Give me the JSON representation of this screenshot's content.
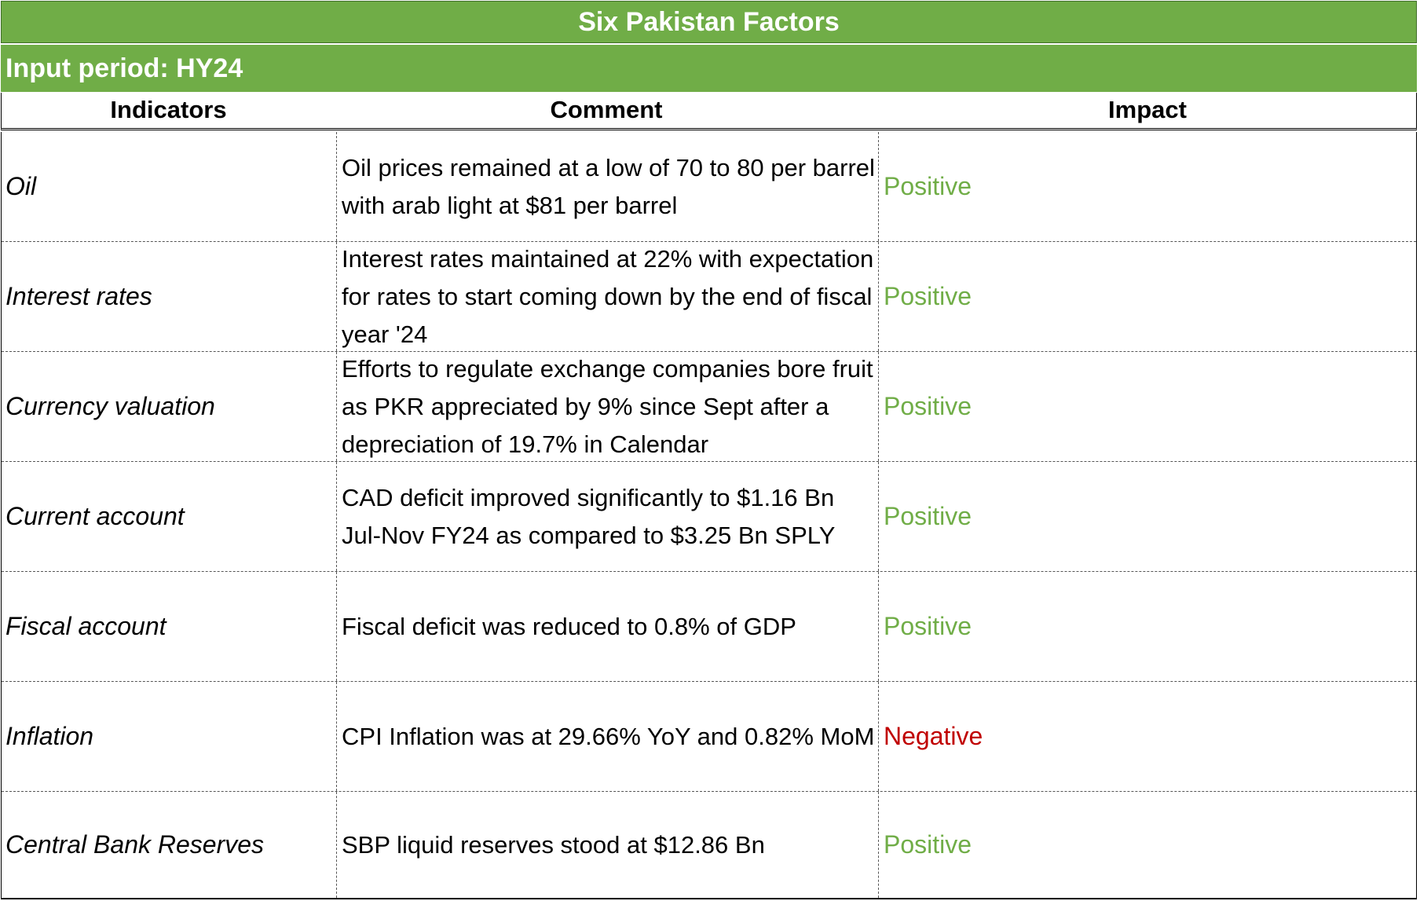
{
  "title": "Six Pakistan Factors",
  "input_period": "Input period: HY24",
  "headers": {
    "indicators": "Indicators",
    "comment": "Comment",
    "impact": "Impact"
  },
  "rows": [
    {
      "indicator": "Oil",
      "comment": "Oil prices remained at a low of 70 to 80 per barrel with arab light at $81 per barrel",
      "impact": "Positive",
      "impact_color": "#70ad47"
    },
    {
      "indicator": "Interest rates",
      "comment": "Interest rates maintained at 22% with expectation for rates to start coming down by the end of fiscal year '24",
      "impact": "Positive",
      "impact_color": "#70ad47"
    },
    {
      "indicator": "Currency valuation",
      "comment": "Efforts to regulate exchange companies bore fruit as PKR appreciated by 9% since Sept after a depreciation of 19.7% in Calendar",
      "impact": "Positive",
      "impact_color": "#70ad47"
    },
    {
      "indicator": "Current account",
      "comment": "CAD deficit improved significantly to $1.16 Bn Jul-Nov FY24 as compared to $3.25 Bn SPLY",
      "impact": "Positive",
      "impact_color": "#70ad47"
    },
    {
      "indicator": "Fiscal account",
      "comment": "Fiscal deficit was reduced to 0.8% of GDP",
      "impact": "Positive",
      "impact_color": "#70ad47"
    },
    {
      "indicator": "Inflation",
      "comment": "CPI Inflation was at 29.66% YoY and 0.82% MoM",
      "impact": "Negative",
      "impact_color": "#c00000"
    },
    {
      "indicator": "Central Bank Reserves",
      "comment": "SBP liquid reserves stood at $12.86 Bn",
      "impact": "Positive",
      "impact_color": "#70ad47"
    }
  ],
  "colors": {
    "header_green": "#70ad47",
    "positive": "#70ad47",
    "negative": "#c00000"
  }
}
